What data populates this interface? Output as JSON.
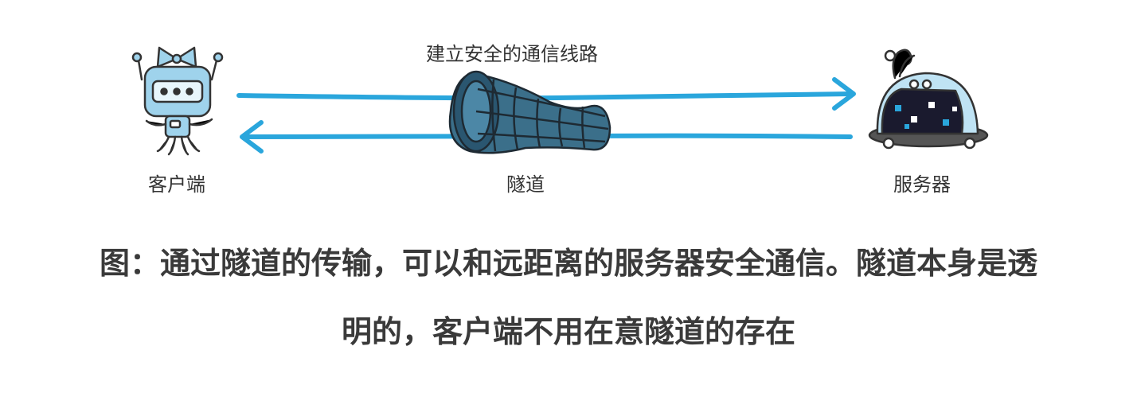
{
  "labels": {
    "top": "建立安全的通信线路",
    "client": "客户端",
    "tunnel": "隧道",
    "server": "服务器"
  },
  "caption": {
    "line1": "图：通过隧道的传输，可以和远距离的服务器安全通信。隧道本身是透",
    "line2": "明的，客户端不用在意隧道的存在"
  },
  "colors": {
    "arrow": "#2aa6dc",
    "robot_body": "#9fd3ec",
    "robot_outline": "#333333",
    "tunnel_fill": "#3b6f8a",
    "server_dome": "#bfe3f4",
    "server_screen": "#1a1a2e"
  },
  "icons": {
    "client": "robot-client-icon",
    "tunnel": "tunnel-icon",
    "server": "dome-server-icon"
  }
}
